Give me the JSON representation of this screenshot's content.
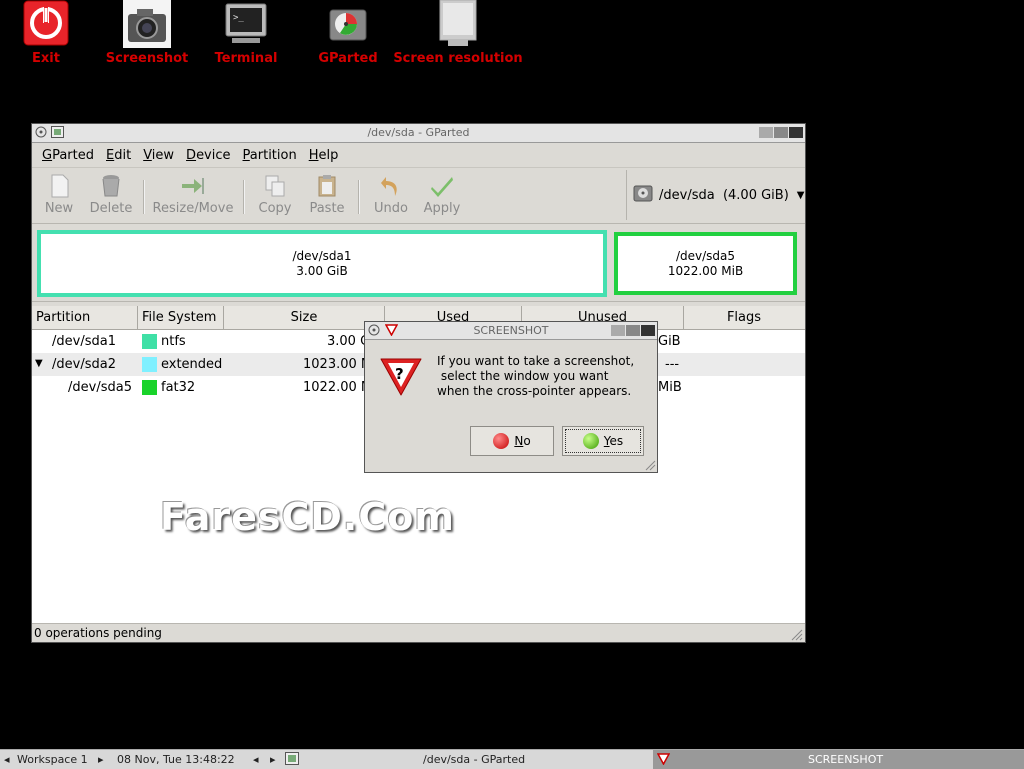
{
  "desktop": {
    "icons": [
      {
        "label": "Exit",
        "icon": "power-icon"
      },
      {
        "label": "Screenshot",
        "icon": "camera-icon"
      },
      {
        "label": "Terminal",
        "icon": "terminal-icon"
      },
      {
        "label": "GParted",
        "icon": "disk-icon"
      },
      {
        "label": "Screen resolution",
        "icon": "monitor-icon"
      }
    ],
    "watermark": "FaresCD.Com"
  },
  "window": {
    "title": "/dev/sda - GParted",
    "menu": [
      "GParted",
      "Edit",
      "View",
      "Device",
      "Partition",
      "Help"
    ],
    "toolbar": {
      "new": "New",
      "delete": "Delete",
      "resize_move": "Resize/Move",
      "copy": "Copy",
      "paste": "Paste",
      "undo": "Undo",
      "apply": "Apply"
    },
    "device_selector": "/dev/sda  (4.00 GiB)",
    "disk_map": {
      "sda1": {
        "name": "/dev/sda1",
        "size": "3.00 GiB"
      },
      "sda5": {
        "name": "/dev/sda5",
        "size": "1022.00 MiB"
      }
    },
    "columns": [
      "Partition",
      "File System",
      "Size",
      "Used",
      "Unused",
      "Flags"
    ],
    "rows": [
      {
        "partition": "/dev/sda1",
        "fs": "ntfs",
        "color": "#3fe0a6",
        "size": "3.00 G",
        "unused": "GiB",
        "flags": ""
      },
      {
        "partition": "/dev/sda2",
        "fs": "extended",
        "color": "#7ff0ff",
        "size": "1023.00 M",
        "unused": "---",
        "flags": ""
      },
      {
        "partition": "/dev/sda5",
        "fs": "fat32",
        "color": "#19d32a",
        "size": "1022.00 M",
        "unused": "MiB",
        "flags": ""
      }
    ],
    "status": "0 operations pending"
  },
  "dialog": {
    "title": "SCREENSHOT",
    "message": "If you want to take a screenshot,\n select the window you want\nwhen the cross-pointer appears.",
    "no": "No",
    "yes": "Yes"
  },
  "taskbar": {
    "workspace": "Workspace 1",
    "datetime": "08 Nov, Tue 13:48:22",
    "task1": "/dev/sda - GParted",
    "task2": "SCREENSHOT"
  }
}
